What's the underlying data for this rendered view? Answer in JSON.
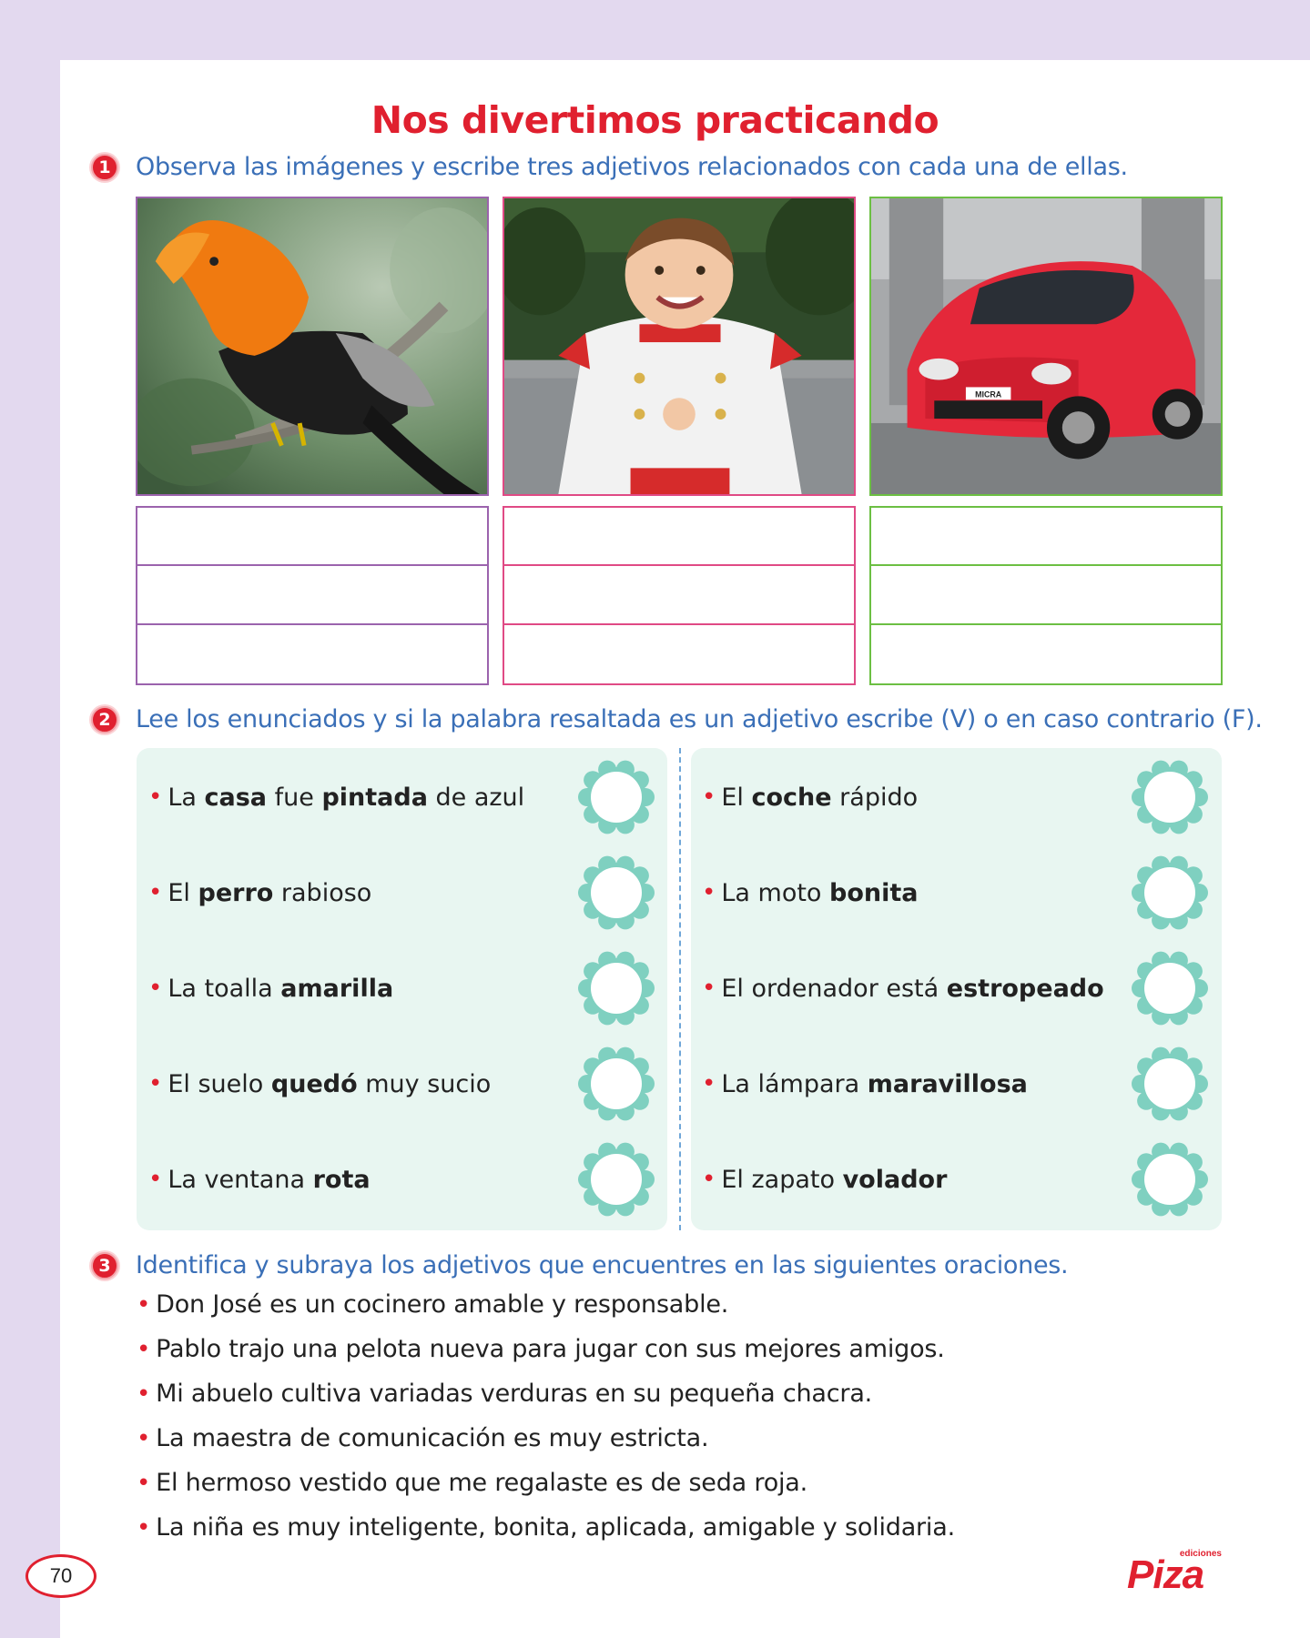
{
  "title": "Nos divertimos practicando",
  "page_number": "70",
  "logo": {
    "small": "ediciones",
    "brand": "Piza"
  },
  "exercise1": {
    "number": "1",
    "instruction": "Observa las imágenes y escribe tres adjetivos relacionados con cada una de ellas.",
    "images": [
      "bird-photo",
      "child-in-costume-photo",
      "red-car-photo"
    ],
    "car_plate": "MICRA"
  },
  "exercise2": {
    "number": "2",
    "instruction": "Lee los enunciados y si la palabra resaltada es un adjetivo escribe (V) o en caso contrario (F).",
    "left": [
      [
        {
          "t": "La "
        },
        {
          "b": "casa"
        },
        {
          "t": " fue "
        },
        {
          "b": "pintada"
        },
        {
          "t": " de azul"
        }
      ],
      [
        {
          "t": "El "
        },
        {
          "b": "perro"
        },
        {
          "t": " rabioso"
        }
      ],
      [
        {
          "t": "La toalla "
        },
        {
          "b": "amarilla"
        }
      ],
      [
        {
          "t": "El suelo "
        },
        {
          "b": "quedó"
        },
        {
          "t": " muy sucio"
        }
      ],
      [
        {
          "t": "La ventana "
        },
        {
          "b": "rota"
        }
      ]
    ],
    "right": [
      [
        {
          "t": "El "
        },
        {
          "b": "coche"
        },
        {
          "t": " rápido"
        }
      ],
      [
        {
          "t": "La moto "
        },
        {
          "b": "bonita"
        }
      ],
      [
        {
          "t": "El ordenador está "
        },
        {
          "b": "estropeado"
        }
      ],
      [
        {
          "t": "La lámpara "
        },
        {
          "b": "maravillosa"
        }
      ],
      [
        {
          "t": "El zapato "
        },
        {
          "b": "volador"
        }
      ]
    ]
  },
  "exercise3": {
    "number": "3",
    "instruction": "Identifica y subraya los adjetivos que encuentres en las siguientes oraciones.",
    "sentences": [
      "Don José es un cocinero amable y responsable.",
      "Pablo trajo una pelota nueva para jugar con sus mejores amigos.",
      "Mi abuelo cultiva variadas verduras en su pequeña chacra.",
      "La maestra de comunicación es muy estricta.",
      "El hermoso vestido que me regalaste es de seda roja.",
      "La niña es muy inteligente, bonita, aplicada, amigable y solidaria."
    ]
  },
  "colors": {
    "title": "#e0202f",
    "instruction": "#3a6fb7",
    "panel": "#e8f6f1",
    "flower": "#7fd0c0"
  }
}
